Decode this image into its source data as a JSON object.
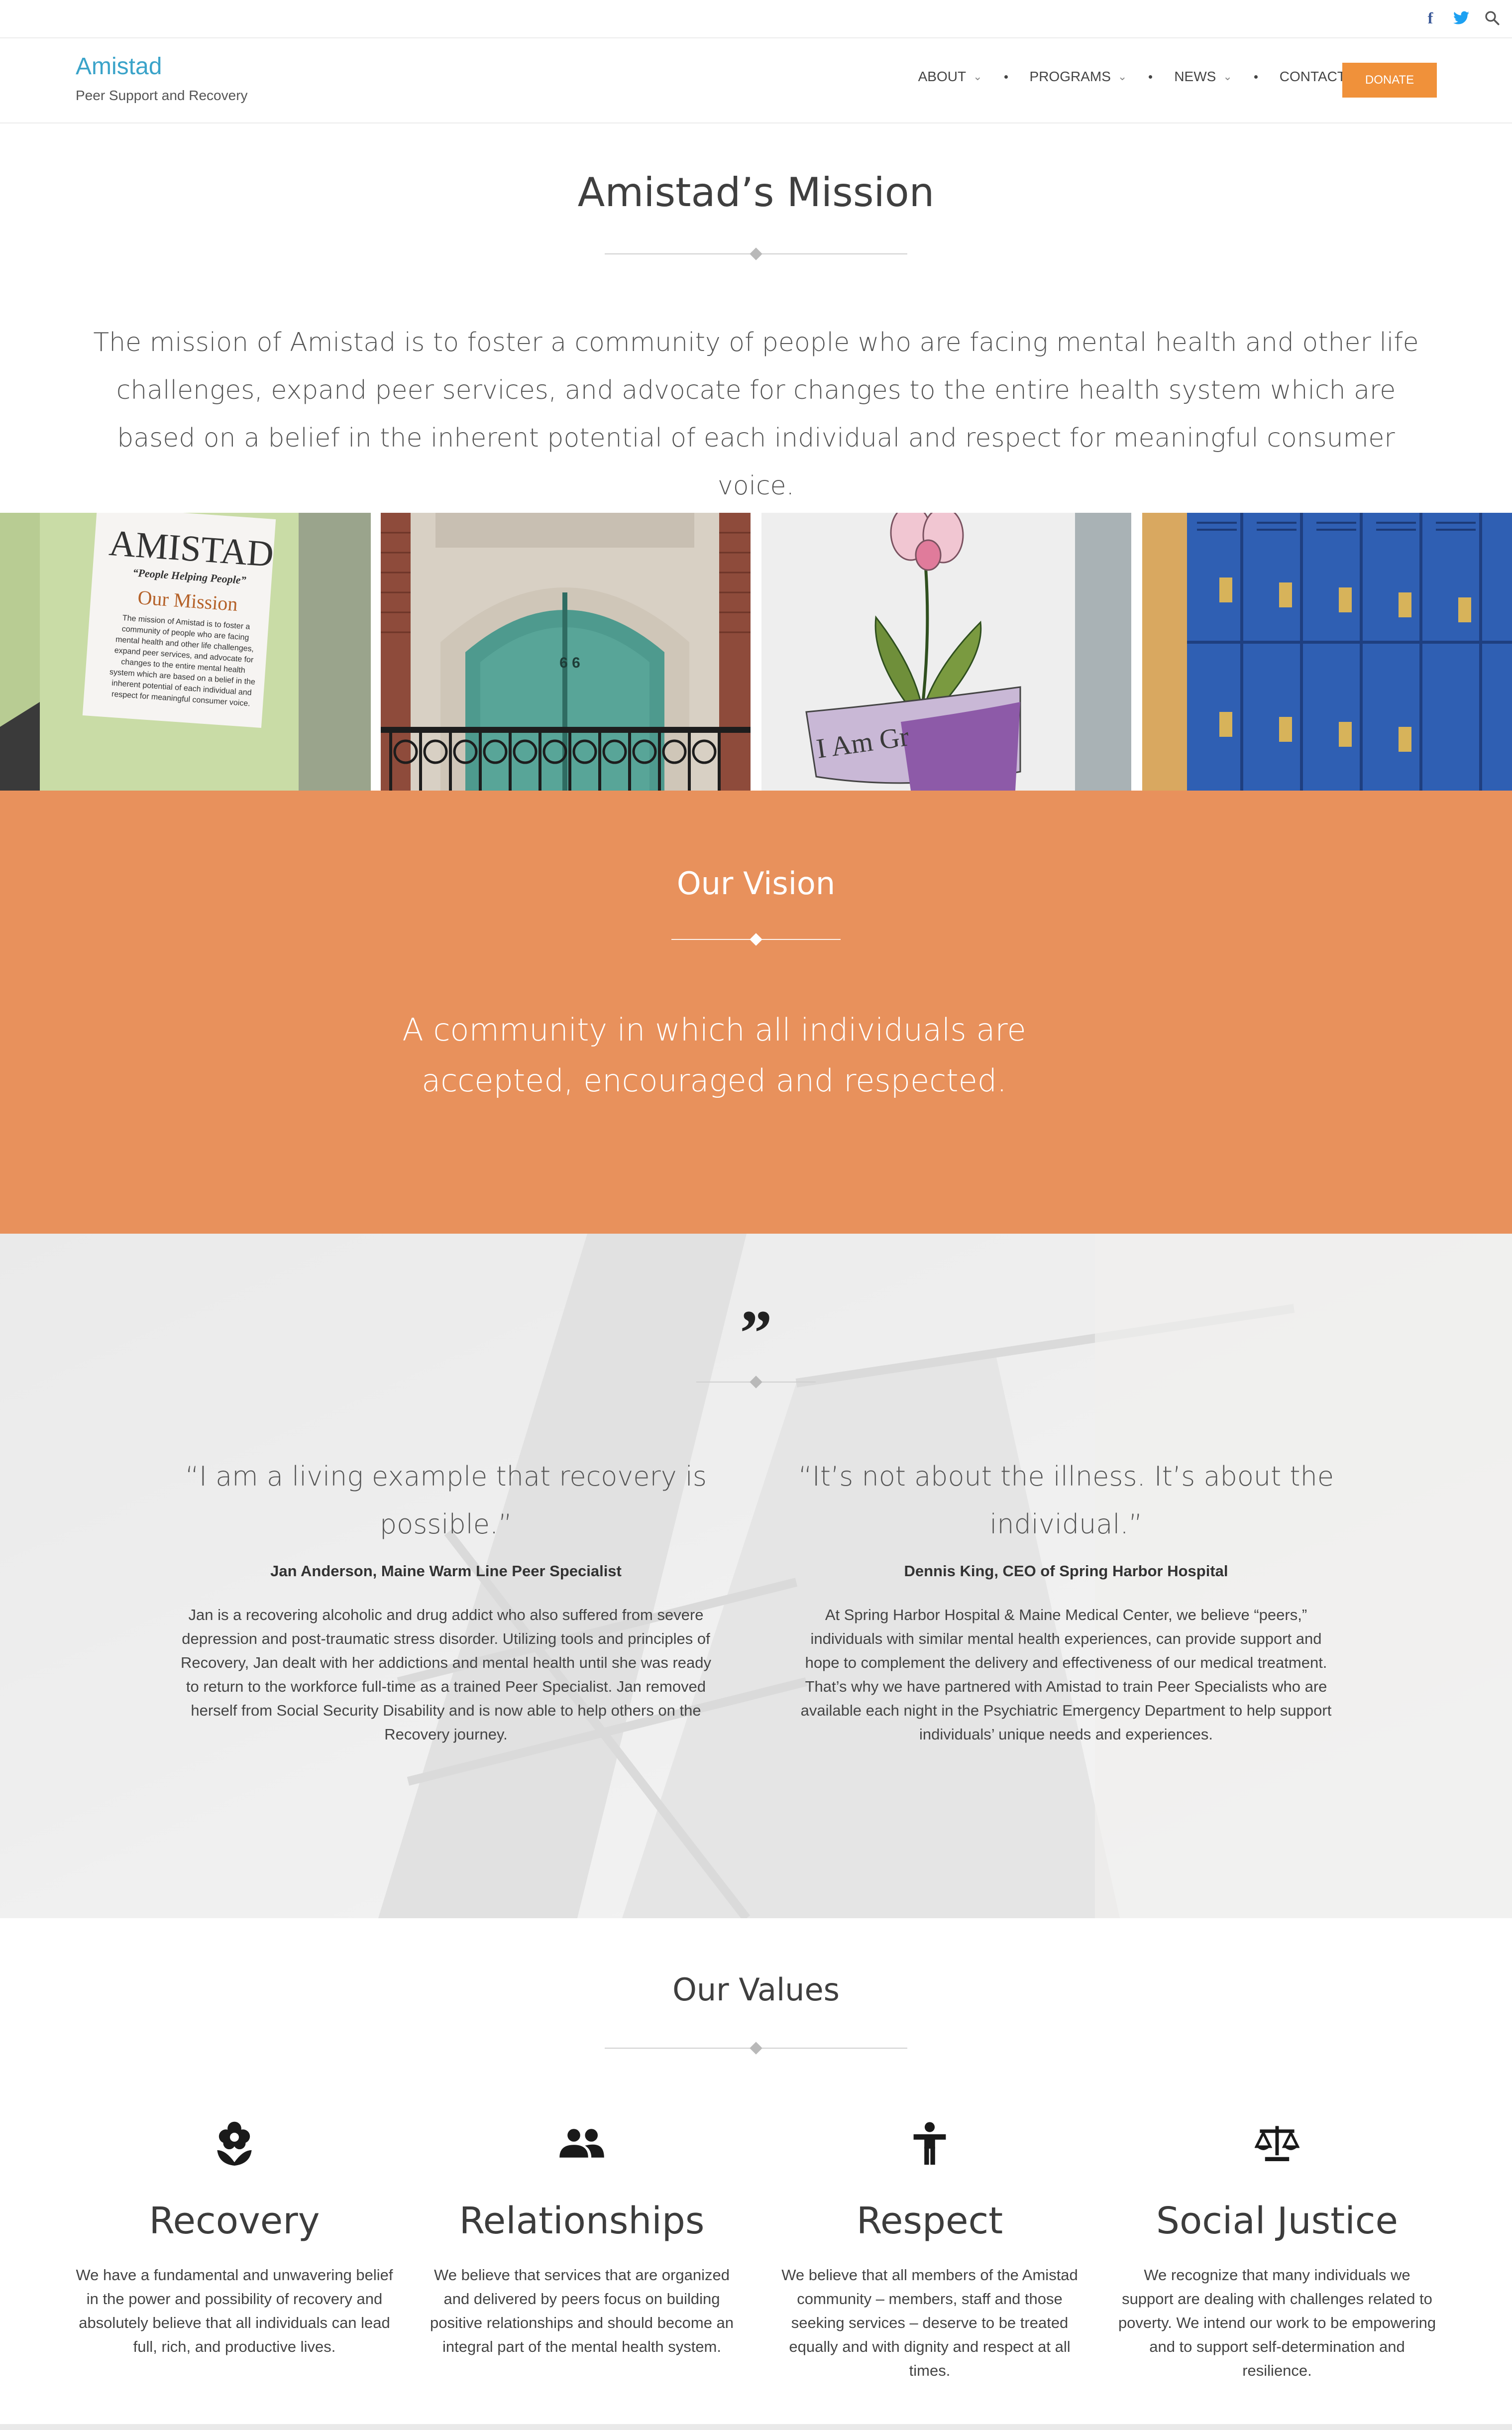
{
  "topbar": {
    "facebook_glyph": "f",
    "twitter_glyph": "🐦",
    "search_glyph": "⌕"
  },
  "header": {
    "brand": "Amistad",
    "tagline": "Peer Support and Recovery",
    "nav": {
      "about": "ABOUT",
      "programs": "PROGRAMS",
      "news": "NEWS",
      "contact": "CONTACT"
    },
    "donate": "DONATE"
  },
  "mission": {
    "title": "Amistad’s Mission",
    "text": "The mission of Amistad is to foster a community of people who are facing mental health and other life challenges, expand peer services, and advocate for changes to the entire health system which are based on a belief in the inherent potential of each individual and respect for meaningful consumer voice."
  },
  "photos": {
    "poster": {
      "title": "AMISTAD",
      "slogan": "“People Helping People”",
      "heading": "Our Mission",
      "body": "The mission of Amistad is to foster a community of people who are facing mental health and other life challenges, expand peer services, and advocate for changes to the entire mental health system which are based on a belief in the inherent potential of each individual and respect for meaningful consumer voice."
    },
    "door_number": "6 6",
    "flower_banner": "I Am Gr"
  },
  "vision": {
    "title": "Our Vision",
    "text": "A community in which all individuals are accepted, encouraged and respected."
  },
  "testimonials": {
    "quote_mark": "”",
    "items": [
      {
        "quote": "“I am a living example that recovery is possible.”",
        "name": "Jan Anderson, Maine Warm Line Peer Specialist",
        "body": "Jan is a recovering alcoholic and drug addict who also suffered from severe depression and post-traumatic stress disorder. Utilizing tools and principles of Recovery, Jan dealt with her addictions and mental health until she was ready to return to the workforce full-time as a trained Peer Specialist. Jan removed herself from Social Security Disability and is now able to help others on the Recovery journey."
      },
      {
        "quote": "“It’s not about the illness. It’s about the individual.”",
        "name": "Dennis King, CEO of Spring Harbor Hospital",
        "body": "At Spring Harbor Hospital & Maine Medical Center, we believe “peers,” individuals with similar mental health experiences, can provide support and hope to complement the delivery and effectiveness of our medical treatment. That’s why we have partnered with Amistad to train Peer Specialists who are available each night in the Psychiatric Emergency Department to help support individuals’ unique needs and experiences."
      }
    ]
  },
  "values": {
    "title": "Our Values",
    "items": [
      {
        "icon": "flower-icon",
        "name": "Recovery",
        "text": "We have a fundamental and unwavering belief in the power and possibility of recovery and absolutely believe that all individuals can lead full, rich, and productive lives."
      },
      {
        "icon": "people-icon",
        "name": "Relationships",
        "text": "We believe that services that are organized and delivered by peers focus on building positive relationships and should become an integral part of the mental health system."
      },
      {
        "icon": "accessibility-icon",
        "name": "Respect",
        "text": "We believe that all members of the Amistad community – members, staff and those seeking services – deserve to be treated equally and with dignity and respect at all times."
      },
      {
        "icon": "scales-icon",
        "name": "Social Justice",
        "text": "We recognize that many individuals we support are dealing with challenges related to poverty. We intend our work to be empowering and to support self-determination and resilience."
      }
    ]
  },
  "colors": {
    "brand_blue": "#3aa3c9",
    "accent_orange": "#f0913a",
    "vision_orange": "#e8915c"
  }
}
